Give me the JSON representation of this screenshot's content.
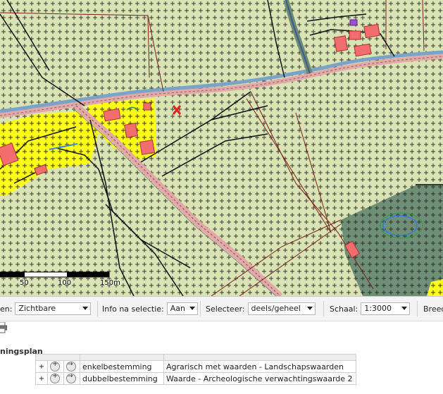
{
  "map": {
    "scale_labels": [
      "50",
      "100",
      "150m"
    ]
  },
  "toolbar": {
    "layers_label": "en:",
    "layers_value": "Zichtbare",
    "info_label": "Info na selectie:",
    "info_value": "Aan",
    "select_label": "Selecteer:",
    "select_value": "deels/geheel",
    "scale_label": "Schaal:",
    "scale_value": "1:3000",
    "breed_label": "Breed"
  },
  "plan": {
    "header": "ningsplan",
    "rows": [
      {
        "type": "enkelbestemming",
        "name": "Agrarisch met waarden - Landschapswaarden"
      },
      {
        "type": "dubbelbestemming",
        "name": "Waarde - Archeologische verwachtingswaarde 2"
      }
    ]
  },
  "colors": {
    "map_background": "#d9e3b4",
    "residential": "#ffff1a",
    "building": "#f26d6d",
    "forest": "#6f8f77",
    "road": "#e6a7a7",
    "water": "#5aa0d8",
    "marker": "#e8201a"
  },
  "icons": [
    "print-icon",
    "zoom-icon",
    "arrow-icon",
    "plus-icon",
    "chevron-down-icon",
    "marker-x-icon"
  ]
}
